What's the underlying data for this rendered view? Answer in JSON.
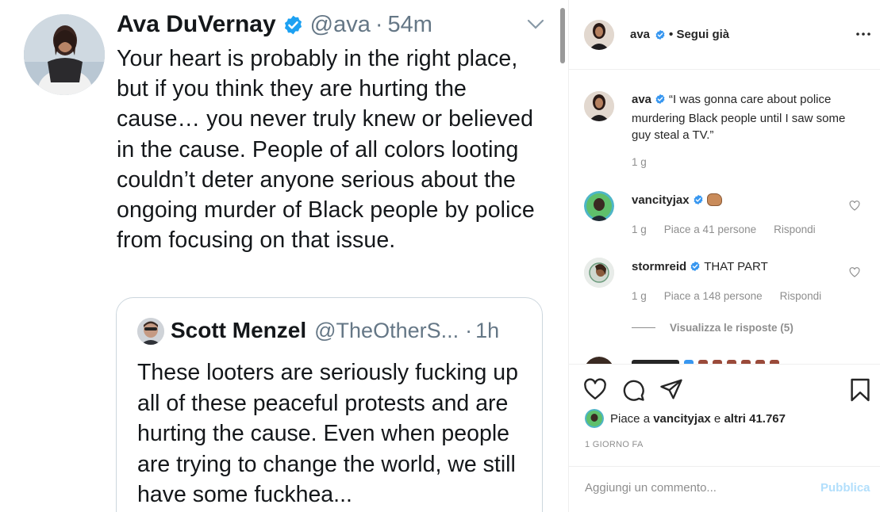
{
  "tweet": {
    "name": "Ava DuVernay",
    "handle": "@ava",
    "separator": "·",
    "time": "54m",
    "text": "Your heart is probably in the right place, but if you think they are hurting the cause… you never truly knew or believed in the cause. People of all colors looting couldn’t deter anyone serious about the ongoing murder of Black people by police from focusing on that issue.",
    "quote": {
      "name": "Scott Menzel",
      "handle": "@TheOtherS...",
      "separator": "·",
      "time": "1h",
      "text": "These looters are seriously fucking up all of these peaceful protests and are hurting the cause. Even when people are trying to change the world, we still have some fuckhea..."
    }
  },
  "instagram": {
    "header": {
      "username": "ava",
      "follow_status": "• Segui già",
      "more_icon": "more-horizontal-icon"
    },
    "caption": {
      "username": "ava",
      "text": "“I was gonna care about police murdering Black people until I saw some guy steal a TV.”",
      "age": "1 g"
    },
    "comments": [
      {
        "username": "vancityjax",
        "text": "",
        "emoji": "fist-bump-emoji",
        "age": "1 g",
        "likes": "Piace a 41 persone",
        "reply": "Rispondi"
      },
      {
        "username": "stormreid",
        "text": "THAT PART",
        "age": "1 g",
        "likes": "Piace a 148 persone",
        "reply": "Rispondi"
      }
    ],
    "view_replies": "Visualizza le risposte (5)",
    "actions": {
      "like_icon": "heart-icon",
      "comment_icon": "comment-icon",
      "share_icon": "share-icon",
      "save_icon": "bookmark-icon"
    },
    "likes_summary": {
      "prefix": "Piace a ",
      "user": "vancityjax",
      "middle": " e ",
      "rest": "altri 41.767"
    },
    "date": "1 GIORNO FA",
    "add_comment_placeholder": "Aggiungi un commento...",
    "publish_label": "Pubblica",
    "colors": {
      "verified": "#3897f0",
      "publish_disabled": "#b2dffc",
      "twitter_verified": "#1da1f2"
    }
  }
}
